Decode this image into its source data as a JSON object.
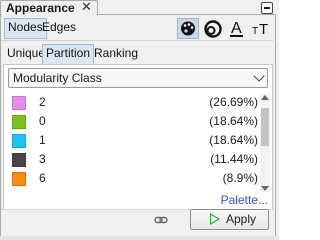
{
  "panel": {
    "title": "Appearance",
    "close_symbol": "✕"
  },
  "element_tabs": {
    "items": [
      {
        "label": "Nodes",
        "active": true
      },
      {
        "label": "Edges",
        "active": false
      }
    ]
  },
  "toolbar_icons": [
    {
      "name": "palette-icon",
      "active": true
    },
    {
      "name": "size-icon",
      "active": false
    },
    {
      "name": "label-color-icon",
      "glyph": "A",
      "active": false
    },
    {
      "name": "label-size-icon",
      "glyph": "тT",
      "active": false
    }
  ],
  "sub_tabs": {
    "items": [
      {
        "label": "Unique",
        "active": false
      },
      {
        "label": "Partition",
        "active": true
      },
      {
        "label": "Ranking",
        "active": false
      }
    ]
  },
  "attribute_select": {
    "selected": "Modularity Class"
  },
  "partitions": [
    {
      "label": "2",
      "percent": "(26.69%)",
      "color": "#e58ded"
    },
    {
      "label": "0",
      "percent": "(18.64%)",
      "color": "#7ec01f"
    },
    {
      "label": "1",
      "percent": "(18.64%)",
      "color": "#1ec3f0"
    },
    {
      "label": "3",
      "percent": "(11.44%)",
      "color": "#4d4545"
    },
    {
      "label": "6",
      "percent": "(8.9%)",
      "color": "#fb8c11"
    }
  ],
  "palette_link": "Palette...",
  "apply_button": {
    "label": "Apply"
  }
}
